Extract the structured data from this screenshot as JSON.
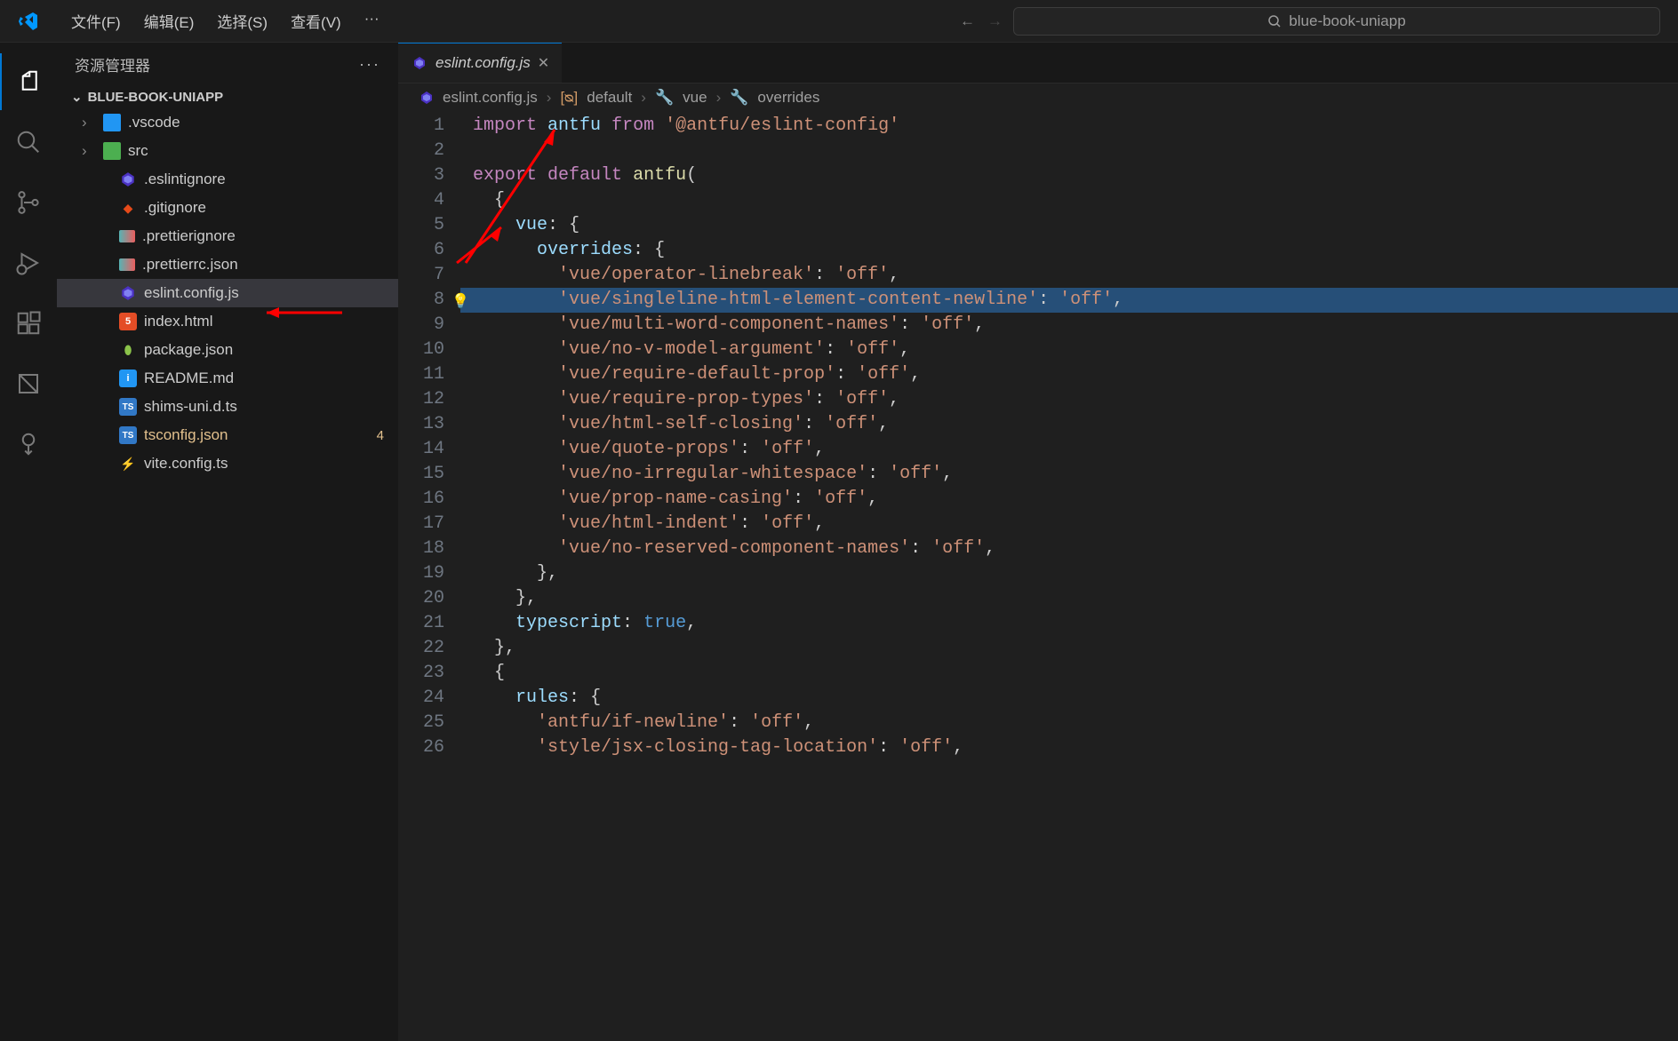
{
  "menu": {
    "file": "文件(F)",
    "edit": "编辑(E)",
    "select": "选择(S)",
    "view": "查看(V)",
    "more": "···"
  },
  "search": {
    "placeholder": "blue-book-uniapp"
  },
  "sidebar": {
    "title": "资源管理器",
    "root": "BLUE-BOOK-UNIAPP",
    "items": [
      {
        "label": ".vscode",
        "kind": "folder-blue",
        "chev": true
      },
      {
        "label": "src",
        "kind": "folder-green",
        "chev": true
      },
      {
        "label": ".eslintignore",
        "kind": "eslint"
      },
      {
        "label": ".gitignore",
        "kind": "git"
      },
      {
        "label": ".prettierignore",
        "kind": "prettier"
      },
      {
        "label": ".prettierrc.json",
        "kind": "prettier"
      },
      {
        "label": "eslint.config.js",
        "kind": "eslint",
        "selected": true
      },
      {
        "label": "index.html",
        "kind": "html"
      },
      {
        "label": "package.json",
        "kind": "json"
      },
      {
        "label": "README.md",
        "kind": "md"
      },
      {
        "label": "shims-uni.d.ts",
        "kind": "ts"
      },
      {
        "label": "tsconfig.json",
        "kind": "ts",
        "mod": true,
        "badge": "4"
      },
      {
        "label": "vite.config.ts",
        "kind": "lightning"
      }
    ]
  },
  "tab": {
    "label": "eslint.config.js"
  },
  "breadcrumb": {
    "file": "eslint.config.js",
    "parts": [
      "default",
      "vue",
      "overrides"
    ]
  },
  "code": {
    "lines": [
      {
        "n": 1,
        "t": [
          [
            "key",
            "import"
          ],
          [
            "",
            " "
          ],
          [
            "ident",
            "antfu"
          ],
          [
            "",
            " "
          ],
          [
            "key",
            "from"
          ],
          [
            "",
            " "
          ],
          [
            "str",
            "'@antfu/eslint-config'"
          ]
        ]
      },
      {
        "n": 2,
        "t": []
      },
      {
        "n": 3,
        "t": [
          [
            "key",
            "export"
          ],
          [
            "",
            " "
          ],
          [
            "key",
            "default"
          ],
          [
            "",
            " "
          ],
          [
            "fn",
            "antfu"
          ],
          [
            "punc",
            "("
          ]
        ]
      },
      {
        "n": 4,
        "t": [
          [
            "",
            "  "
          ],
          [
            "punc",
            "{"
          ]
        ]
      },
      {
        "n": 5,
        "t": [
          [
            "",
            "    "
          ],
          [
            "ident",
            "vue"
          ],
          [
            "punc",
            ":"
          ],
          [
            "",
            " "
          ],
          [
            "punc",
            "{"
          ]
        ]
      },
      {
        "n": 6,
        "t": [
          [
            "",
            "      "
          ],
          [
            "ident",
            "overrides"
          ],
          [
            "punc",
            ":"
          ],
          [
            "",
            " "
          ],
          [
            "punc",
            "{"
          ]
        ]
      },
      {
        "n": 7,
        "t": [
          [
            "",
            "        "
          ],
          [
            "str",
            "'vue/operator-linebreak'"
          ],
          [
            "punc",
            ":"
          ],
          [
            "",
            " "
          ],
          [
            "str",
            "'off'"
          ],
          [
            "punc",
            ","
          ]
        ]
      },
      {
        "n": 8,
        "hl": true,
        "bulb": true,
        "t": [
          [
            "",
            "        "
          ],
          [
            "str",
            "'vue/singleline-html-element-content-newline'"
          ],
          [
            "punc",
            ":"
          ],
          [
            "",
            " "
          ],
          [
            "str",
            "'off'"
          ],
          [
            "punc",
            ","
          ]
        ]
      },
      {
        "n": 9,
        "t": [
          [
            "",
            "        "
          ],
          [
            "str",
            "'vue/multi-word-component-names'"
          ],
          [
            "punc",
            ":"
          ],
          [
            "",
            " "
          ],
          [
            "str",
            "'off'"
          ],
          [
            "punc",
            ","
          ]
        ]
      },
      {
        "n": 10,
        "t": [
          [
            "",
            "        "
          ],
          [
            "str",
            "'vue/no-v-model-argument'"
          ],
          [
            "punc",
            ":"
          ],
          [
            "",
            " "
          ],
          [
            "str",
            "'off'"
          ],
          [
            "punc",
            ","
          ]
        ]
      },
      {
        "n": 11,
        "t": [
          [
            "",
            "        "
          ],
          [
            "str",
            "'vue/require-default-prop'"
          ],
          [
            "punc",
            ":"
          ],
          [
            "",
            " "
          ],
          [
            "str",
            "'off'"
          ],
          [
            "punc",
            ","
          ]
        ]
      },
      {
        "n": 12,
        "t": [
          [
            "",
            "        "
          ],
          [
            "str",
            "'vue/require-prop-types'"
          ],
          [
            "punc",
            ":"
          ],
          [
            "",
            " "
          ],
          [
            "str",
            "'off'"
          ],
          [
            "punc",
            ","
          ]
        ]
      },
      {
        "n": 13,
        "t": [
          [
            "",
            "        "
          ],
          [
            "str",
            "'vue/html-self-closing'"
          ],
          [
            "punc",
            ":"
          ],
          [
            "",
            " "
          ],
          [
            "str",
            "'off'"
          ],
          [
            "punc",
            ","
          ]
        ]
      },
      {
        "n": 14,
        "t": [
          [
            "",
            "        "
          ],
          [
            "str",
            "'vue/quote-props'"
          ],
          [
            "punc",
            ":"
          ],
          [
            "",
            " "
          ],
          [
            "str",
            "'off'"
          ],
          [
            "punc",
            ","
          ]
        ]
      },
      {
        "n": 15,
        "t": [
          [
            "",
            "        "
          ],
          [
            "str",
            "'vue/no-irregular-whitespace'"
          ],
          [
            "punc",
            ":"
          ],
          [
            "",
            " "
          ],
          [
            "str",
            "'off'"
          ],
          [
            "punc",
            ","
          ]
        ]
      },
      {
        "n": 16,
        "t": [
          [
            "",
            "        "
          ],
          [
            "str",
            "'vue/prop-name-casing'"
          ],
          [
            "punc",
            ":"
          ],
          [
            "",
            " "
          ],
          [
            "str",
            "'off'"
          ],
          [
            "punc",
            ","
          ]
        ]
      },
      {
        "n": 17,
        "t": [
          [
            "",
            "        "
          ],
          [
            "str",
            "'vue/html-indent'"
          ],
          [
            "punc",
            ":"
          ],
          [
            "",
            " "
          ],
          [
            "str",
            "'off'"
          ],
          [
            "punc",
            ","
          ]
        ]
      },
      {
        "n": 18,
        "t": [
          [
            "",
            "        "
          ],
          [
            "str",
            "'vue/no-reserved-component-names'"
          ],
          [
            "punc",
            ":"
          ],
          [
            "",
            " "
          ],
          [
            "str",
            "'off'"
          ],
          [
            "punc",
            ","
          ]
        ]
      },
      {
        "n": 19,
        "t": [
          [
            "",
            "      "
          ],
          [
            "punc",
            "},"
          ]
        ]
      },
      {
        "n": 20,
        "t": [
          [
            "",
            "    "
          ],
          [
            "punc",
            "},"
          ]
        ]
      },
      {
        "n": 21,
        "t": [
          [
            "",
            "    "
          ],
          [
            "ident",
            "typescript"
          ],
          [
            "punc",
            ":"
          ],
          [
            "",
            " "
          ],
          [
            "bool",
            "true"
          ],
          [
            "punc",
            ","
          ]
        ]
      },
      {
        "n": 22,
        "t": [
          [
            "",
            "  "
          ],
          [
            "punc",
            "},"
          ]
        ]
      },
      {
        "n": 23,
        "t": [
          [
            "",
            "  "
          ],
          [
            "punc",
            "{"
          ]
        ]
      },
      {
        "n": 24,
        "t": [
          [
            "",
            "    "
          ],
          [
            "ident",
            "rules"
          ],
          [
            "punc",
            ":"
          ],
          [
            "",
            " "
          ],
          [
            "punc",
            "{"
          ]
        ]
      },
      {
        "n": 25,
        "t": [
          [
            "",
            "      "
          ],
          [
            "str",
            "'antfu/if-newline'"
          ],
          [
            "punc",
            ":"
          ],
          [
            "",
            " "
          ],
          [
            "str",
            "'off'"
          ],
          [
            "punc",
            ","
          ]
        ]
      },
      {
        "n": 26,
        "t": [
          [
            "",
            "      "
          ],
          [
            "str",
            "'style/jsx-closing-tag-location'"
          ],
          [
            "punc",
            ":"
          ],
          [
            "",
            " "
          ],
          [
            "str",
            "'off'"
          ],
          [
            "punc",
            ","
          ]
        ]
      }
    ]
  }
}
